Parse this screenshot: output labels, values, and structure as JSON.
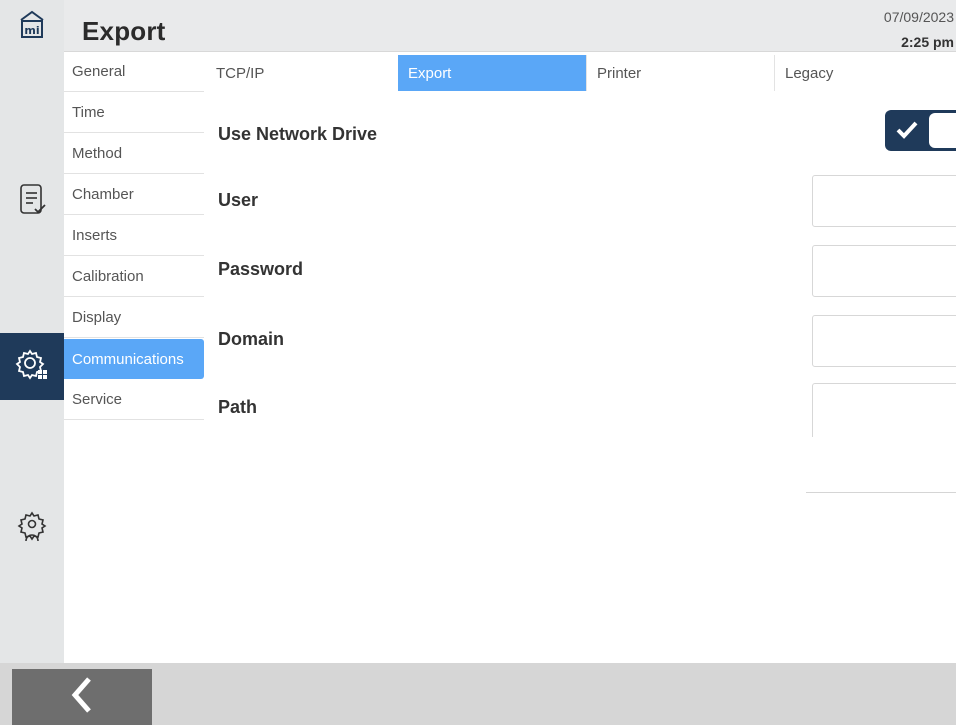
{
  "header": {
    "title": "Export",
    "date": "07/09/2023",
    "time": "2:25 pm"
  },
  "rail": {
    "home_icon": "home-mi-icon",
    "items": [
      "methods-checklist-icon",
      "settings-gears-icon",
      "user-gear-icon"
    ],
    "active": "settings-gears-icon",
    "active_color": "#1f3a5a"
  },
  "sidebar": {
    "items": [
      {
        "label": "General"
      },
      {
        "label": "Time"
      },
      {
        "label": "Method"
      },
      {
        "label": "Chamber"
      },
      {
        "label": "Inserts"
      },
      {
        "label": "Calibration"
      },
      {
        "label": "Display"
      },
      {
        "label": "Communications"
      },
      {
        "label": "Service"
      }
    ],
    "active_index": 7,
    "accent": "#5aa7f7"
  },
  "tabs": {
    "items": [
      {
        "label": "TCP/IP"
      },
      {
        "label": "Export"
      },
      {
        "label": "Printer"
      },
      {
        "label": "Legacy"
      }
    ],
    "active_index": 1
  },
  "form": {
    "use_network_drive": {
      "label": "Use Network Drive",
      "checked": true
    },
    "user": {
      "label": "User",
      "value": ""
    },
    "password": {
      "label": "Password",
      "value": ""
    },
    "domain": {
      "label": "Domain",
      "value": ""
    },
    "path": {
      "label": "Path",
      "value": ""
    }
  },
  "footer": {
    "back_icon": "chevron-left-icon"
  }
}
